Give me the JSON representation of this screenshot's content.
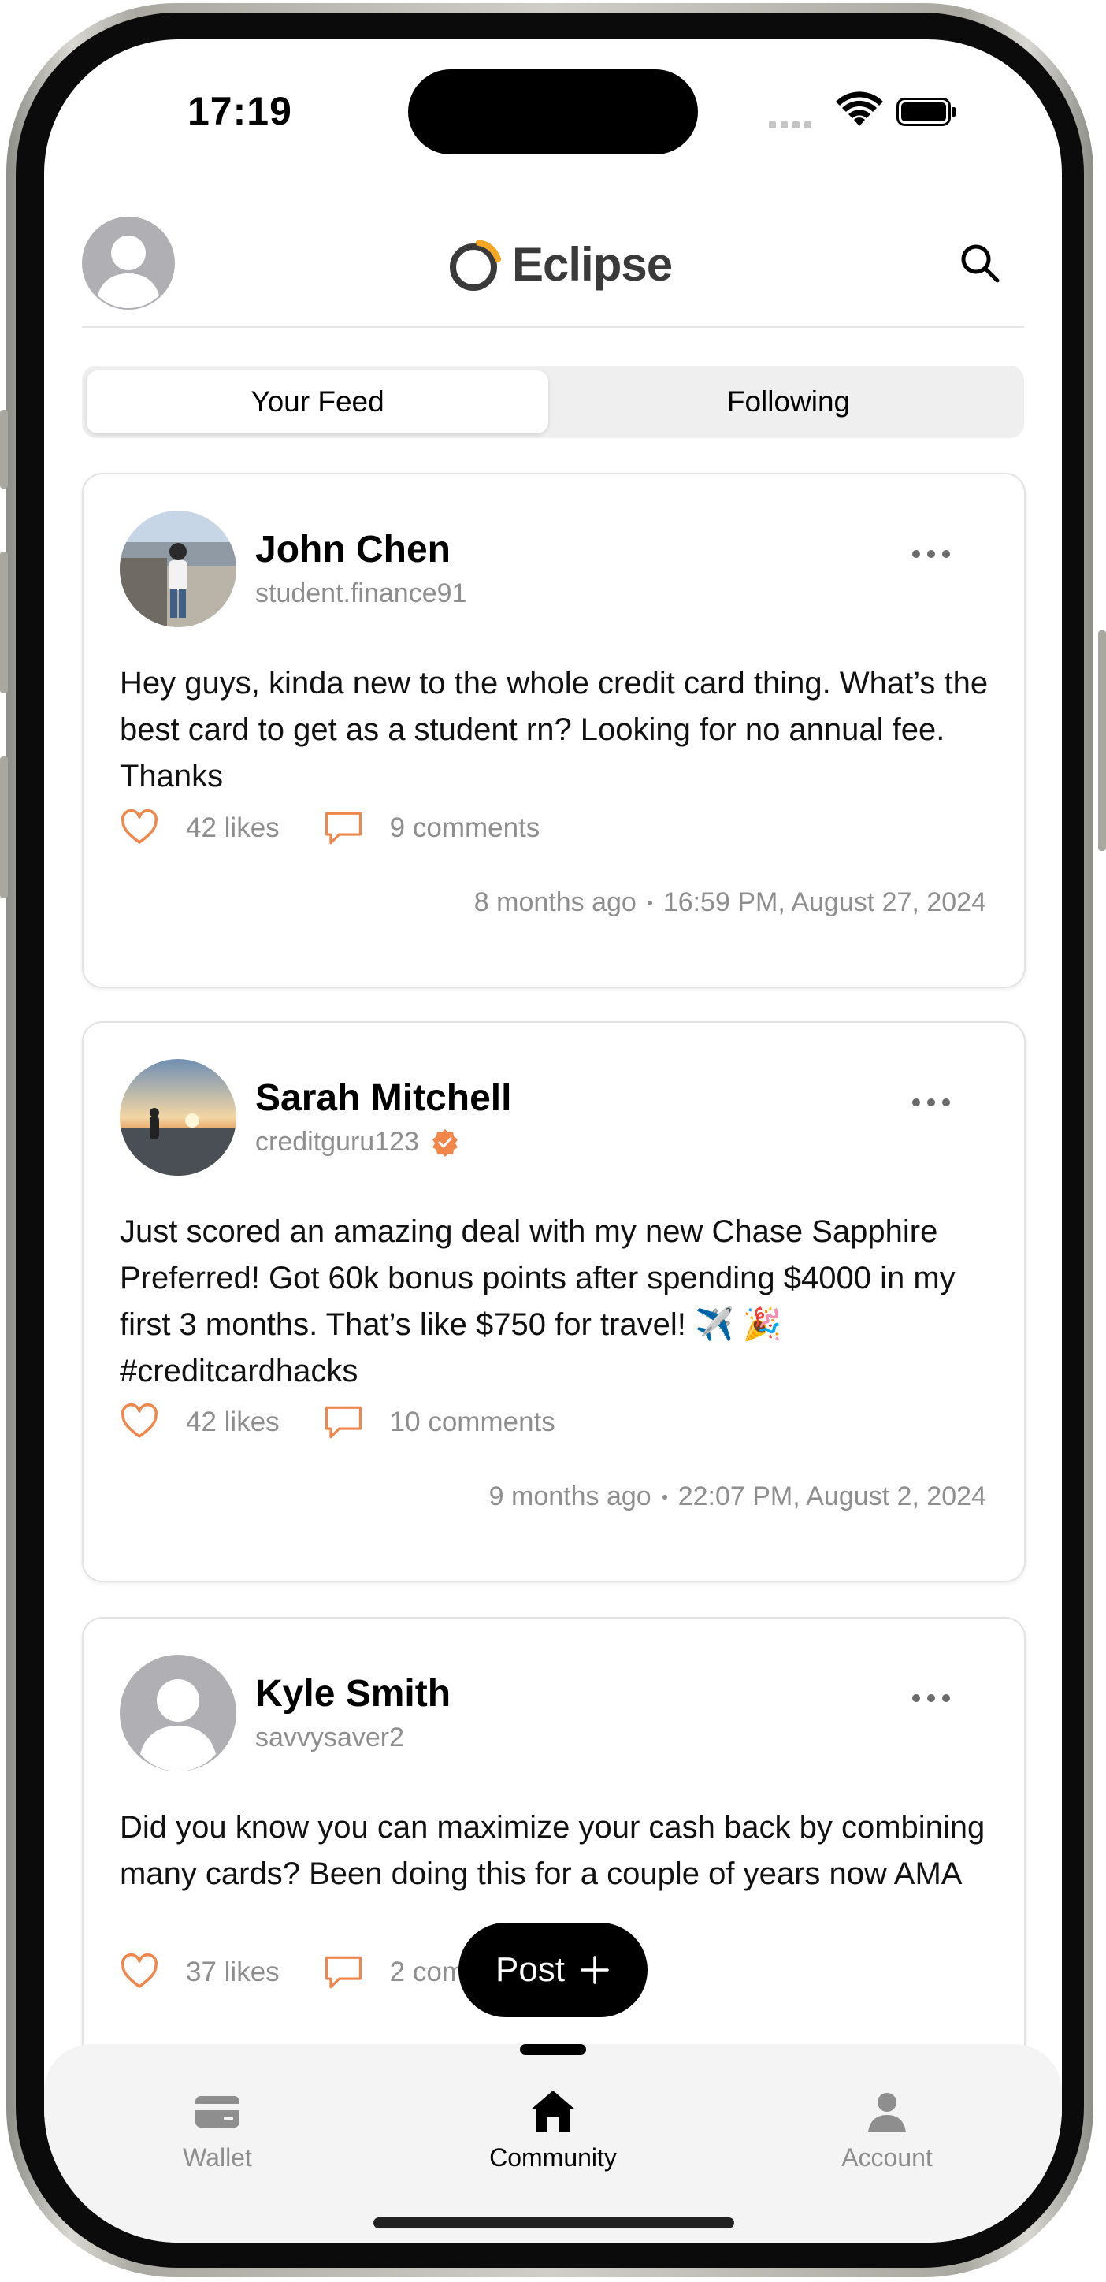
{
  "status_bar": {
    "time": "17:19"
  },
  "header": {
    "brand": "Eclipse",
    "brand_accent": "#f5a623"
  },
  "tabs": [
    {
      "label": "Your Feed",
      "active": true
    },
    {
      "label": "Following",
      "active": false
    }
  ],
  "posts": [
    {
      "name": "John Chen",
      "handle": "student.finance91",
      "verified": false,
      "body": "Hey guys, kinda new to the whole credit card thing. What’s the best card to get as a student rn? Looking for no annual fee. Thanks",
      "likes": "42 likes",
      "comments": "9 comments",
      "relative_time": "8 months ago",
      "timestamp": "16:59 PM, August 27, 2024"
    },
    {
      "name": "Sarah Mitchell",
      "handle": "creditguru123",
      "verified": true,
      "body": "Just scored an amazing deal with my new Chase Sapphire Preferred! Got 60k bonus points after spending $4000 in my first 3 months. That’s like $750 for travel! ✈️ 🎉  #creditcardhacks",
      "likes": "42 likes",
      "comments": "10 comments",
      "relative_time": "9 months ago",
      "timestamp": "22:07 PM, August 2, 2024"
    },
    {
      "name": "Kyle Smith",
      "handle": "savvysaver2",
      "verified": false,
      "body": "Did you know you can maximize your cash back by combining many cards? Been doing this for a couple of years now AMA",
      "likes": "37 likes",
      "comments": "2 comments"
    }
  ],
  "post_button": {
    "label": "Post"
  },
  "nav": [
    {
      "label": "Wallet",
      "icon": "wallet-icon",
      "active": false
    },
    {
      "label": "Community",
      "icon": "home-icon",
      "active": true
    },
    {
      "label": "Account",
      "icon": "person-icon",
      "active": false
    }
  ],
  "colors": {
    "accent": "#f0864a",
    "muted": "#8e8e8e"
  }
}
